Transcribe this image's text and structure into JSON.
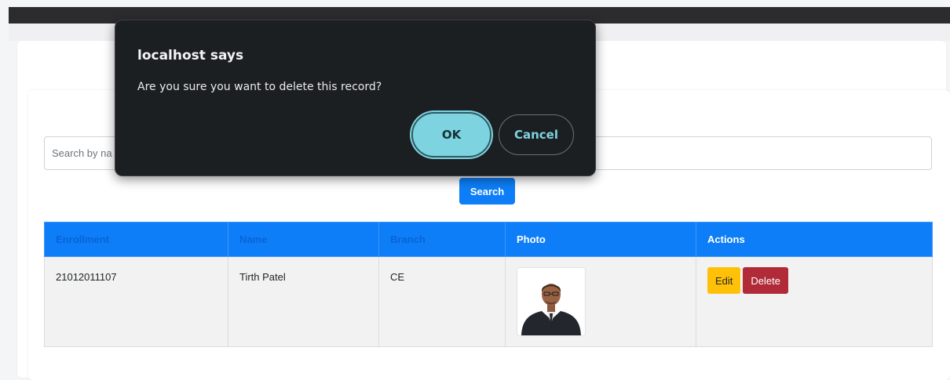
{
  "dialog": {
    "title": "localhost says",
    "message": "Are you sure you want to delete this record?",
    "ok_label": "OK",
    "cancel_label": "Cancel"
  },
  "search": {
    "placeholder": "Search by na",
    "value": "",
    "button_label": "Search"
  },
  "table": {
    "headers": [
      "Enrollment",
      "Name",
      "Branch",
      "Photo",
      "Actions"
    ],
    "rows": [
      {
        "enrollment": "21012011107",
        "name": "Tirth Patel",
        "branch": "CE",
        "photo": "person-photo",
        "actions": {
          "edit_label": "Edit",
          "delete_label": "Delete"
        }
      }
    ]
  },
  "colors": {
    "primary": "#0d7ef7",
    "edit": "#ffc107",
    "delete": "#b02a37",
    "dialog_bg": "#1c1f22",
    "dialog_accent": "#7dd3e0"
  }
}
